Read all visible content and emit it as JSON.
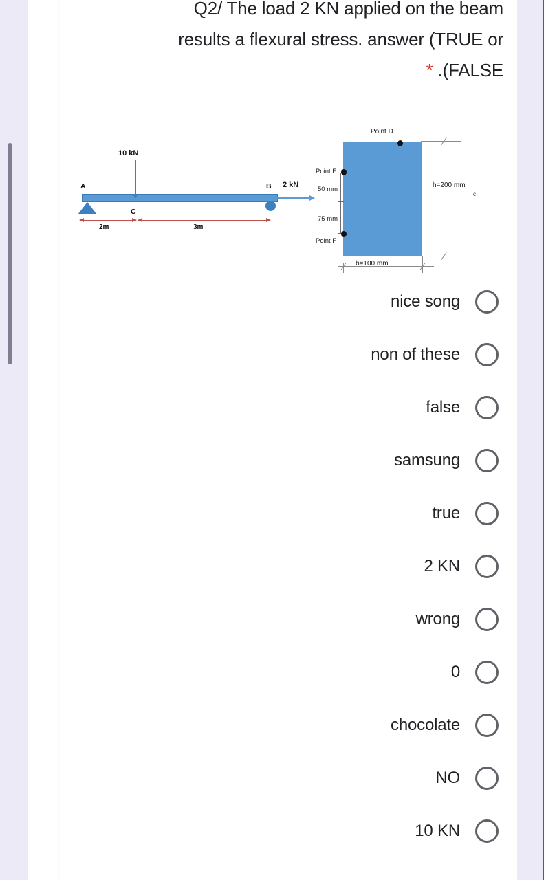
{
  "question": {
    "lines": [
      "Q2/ The load 2 KN applied on the beam",
      "results a flexural stress. answer (TRUE or",
      ".(FALSE"
    ],
    "required_marker": "*"
  },
  "beam_diagram": {
    "point_a": "A",
    "point_b": "B",
    "point_c": "C",
    "load_vertical": "10 kN",
    "load_axial": "2 kN",
    "dim_left": "2m",
    "dim_right": "3m",
    "beam_color": "#5b9bd5",
    "dim_color": "#c0504d"
  },
  "section_diagram": {
    "point_d": "Point D",
    "point_e": "Point E",
    "point_f": "Point F",
    "dist_above": "50 mm",
    "dist_below": "75 mm",
    "height": "h=200 mm",
    "centroid": "c",
    "width": "b=100 mm",
    "fill_color": "#5b9bd5"
  },
  "options": [
    {
      "label": "nice song",
      "selected": false
    },
    {
      "label": "non of these",
      "selected": false
    },
    {
      "label": "false",
      "selected": false
    },
    {
      "label": "samsung",
      "selected": false
    },
    {
      "label": "true",
      "selected": false
    },
    {
      "label": "2 KN",
      "selected": false
    },
    {
      "label": "wrong",
      "selected": false
    },
    {
      "label": "0",
      "selected": false
    },
    {
      "label": "chocolate",
      "selected": false
    },
    {
      "label": "NO",
      "selected": false
    },
    {
      "label": "10 KN",
      "selected": false
    }
  ],
  "colors": {
    "page_background": "#eceaf6",
    "card_background": "#ffffff",
    "text": "#202124",
    "required_star": "#d93025",
    "radio_border": "#5f6368"
  }
}
